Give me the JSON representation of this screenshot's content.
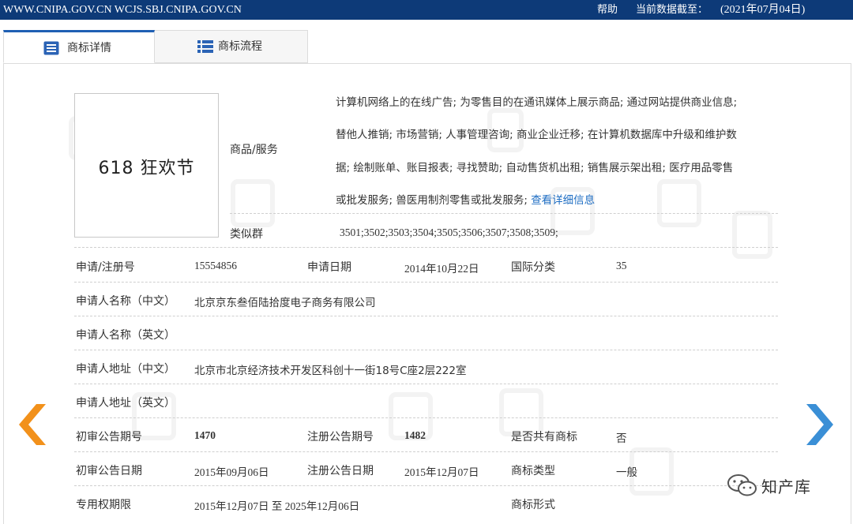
{
  "topbar": {
    "url": "WWW.CNIPA.GOV.CN WCJS.SBJ.CNIPA.GOV.CN",
    "help": "帮助",
    "as_of_label": "当前数据截至：",
    "as_of_date": "(2021年07月04日)"
  },
  "tabs": [
    {
      "label": "商标详情",
      "active": true
    },
    {
      "label": "商标流程",
      "active": false
    }
  ],
  "mark": {
    "text": "618 狂欢节"
  },
  "goods_services": {
    "label": "商品/服务",
    "lines": [
      "计算机网络上的在线广告; 为零售目的在通讯媒体上展示商品; 通过网站提供商业信息;",
      "替他人推销; 市场营销; 人事管理咨询; 商业企业迁移; 在计算机数据库中升级和维护数",
      "据; 绘制账单、账目报表; 寻找赞助; 自动售货机出租; 销售展示架出租; 医疗用品零售",
      "或批发服务; 兽医用制剂零售或批发服务; "
    ],
    "detail_link": "查看详细信息"
  },
  "similar_group": {
    "label": "类似群",
    "value": "3501;3502;3503;3504;3505;3506;3507;3508;3509;"
  },
  "rows": {
    "reg_no": {
      "label": "申请/注册号",
      "value": "15554856"
    },
    "app_date": {
      "label": "申请日期",
      "value": "2014年10月22日"
    },
    "intl_class": {
      "label": "国际分类",
      "value": "35"
    },
    "applicant_cn": {
      "label": "申请人名称（中文）",
      "value": "北京京东叁佰陆拾度电子商务有限公司"
    },
    "applicant_en": {
      "label": "申请人名称（英文）",
      "value": ""
    },
    "address_cn": {
      "label": "申请人地址（中文）",
      "value": "北京市北京经济技术开发区科创十一街18号C座2层222室"
    },
    "address_en": {
      "label": "申请人地址（英文）",
      "value": ""
    },
    "prelim_no": {
      "label": "初审公告期号",
      "value": "1470"
    },
    "reg_pub_no": {
      "label": "注册公告期号",
      "value": "1482"
    },
    "shared": {
      "label": "是否共有商标",
      "value": "否"
    },
    "prelim_date": {
      "label": "初审公告日期",
      "value": "2015年09月06日"
    },
    "reg_pub_date": {
      "label": "注册公告日期",
      "value": "2015年12月07日"
    },
    "mark_type": {
      "label": "商标类型",
      "value": "一般"
    },
    "exclusive_period": {
      "label": "专用权期限",
      "value": "2015年12月07日 至 2025年12月06日"
    },
    "mark_form": {
      "label": "商标形式",
      "value": ""
    }
  },
  "watermark_brand": "知产库",
  "colors": {
    "topbar": "#0d3a78",
    "tab_accent": "#1f5fb3",
    "link": "#1f6ec3",
    "arrow_left": "#f2911b",
    "arrow_right": "#3a8fd6"
  }
}
